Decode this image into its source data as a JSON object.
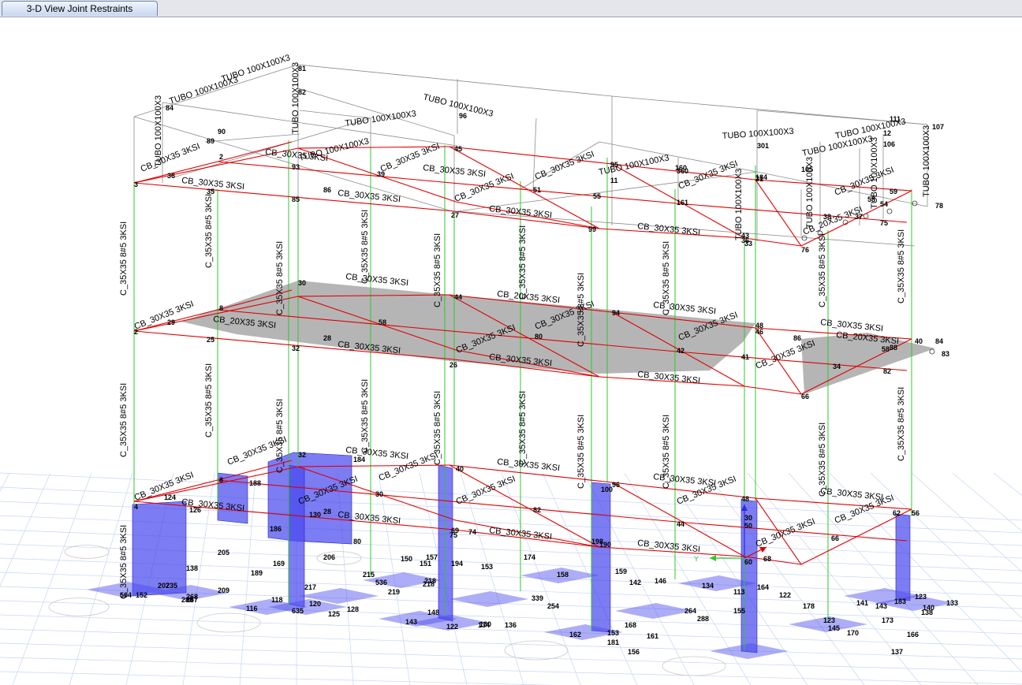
{
  "window": {
    "tab_title": "3-D View  Joint Restraints"
  },
  "colors": {
    "beam": "#e00000",
    "column": "#2ec82e",
    "roof": "#8c8c8c",
    "slab": "#a8a8a8",
    "wall": "#4a4aee",
    "grid": "#c5d6f2"
  },
  "sections": {
    "column": "C_35X35 8#5 3KSI",
    "beam_main": "CB_30X35 3KSI",
    "beam_secondary": "CB_20X35 3KSI",
    "roof_tube": "TUBO 100X100X3"
  },
  "joints": {
    "roof": [
      "81",
      "82",
      "84",
      "90",
      "89",
      "96",
      "95",
      "93",
      "39",
      "3",
      "2",
      "36",
      "35",
      "86",
      "85",
      "45",
      "51",
      "27",
      "55",
      "99",
      "11",
      "301",
      "160",
      "360",
      "161",
      "43",
      "31",
      "184",
      "12",
      "106",
      "105",
      "107",
      "111",
      "76",
      "78",
      "75",
      "38",
      "37",
      "58",
      "33",
      "59",
      "54"
    ],
    "level2": [
      "30",
      "8",
      "29",
      "2",
      "25",
      "32",
      "28",
      "44",
      "58",
      "26",
      "94",
      "80",
      "42",
      "36",
      "48",
      "41",
      "46",
      "86",
      "34",
      "58",
      "88",
      "82",
      "83",
      "84",
      "40",
      "66"
    ],
    "level1": [
      "32",
      "184",
      "188",
      "8",
      "124",
      "126",
      "4",
      "28",
      "130",
      "40",
      "30",
      "96",
      "82",
      "100",
      "44",
      "48",
      "66",
      "62",
      "56",
      "186",
      "80",
      "75",
      "74",
      "190",
      "194",
      "68",
      "60",
      "30",
      "198",
      "69",
      "50"
    ],
    "base": [
      "504",
      "152",
      "207",
      "235",
      "267",
      "268",
      "209",
      "288",
      "138",
      "189",
      "169",
      "205",
      "206",
      "116",
      "118",
      "635",
      "120",
      "125",
      "128",
      "217",
      "215",
      "536",
      "219",
      "218",
      "150",
      "157",
      "151",
      "153",
      "218",
      "130",
      "143",
      "148",
      "122",
      "134",
      "136",
      "174",
      "339",
      "254",
      "158",
      "162",
      "153",
      "168",
      "161",
      "181",
      "156",
      "159",
      "142",
      "146",
      "264",
      "288",
      "155",
      "113",
      "134",
      "164",
      "122",
      "145",
      "123",
      "178",
      "170",
      "173",
      "143",
      "141",
      "140",
      "133",
      "137",
      "166",
      "138",
      "123",
      "183"
    ]
  },
  "axes": {
    "y_label": "Y"
  }
}
